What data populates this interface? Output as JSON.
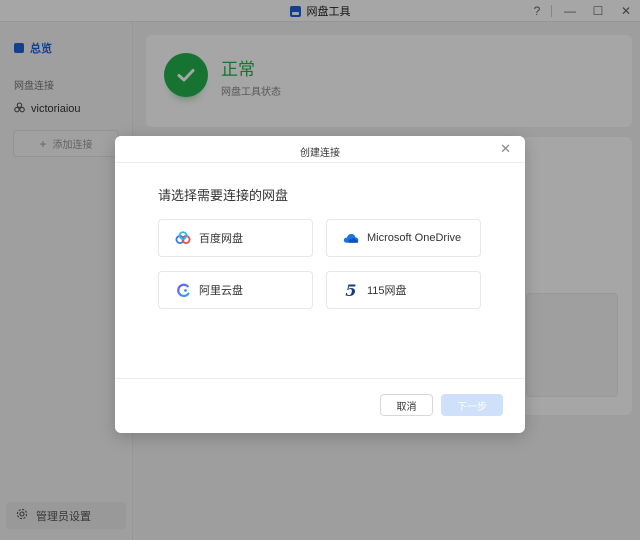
{
  "window": {
    "title": "网盘工具",
    "help": "?",
    "minimize": "—",
    "maximize": "☐",
    "close": "✕"
  },
  "sidebar": {
    "overview": "总览",
    "section_label": "网盘连接",
    "account": "victoriaiou",
    "add_connection": "添加连接",
    "admin_settings": "管理员设置"
  },
  "status": {
    "title": "正常",
    "subtitle": "网盘工具状态"
  },
  "dialog": {
    "title": "创建连接",
    "close": "✕",
    "prompt": "请选择需要连接的网盘",
    "options": [
      {
        "label": "百度网盘",
        "icon": "baidu-netdisk-icon"
      },
      {
        "label": "Microsoft OneDrive",
        "icon": "onedrive-icon"
      },
      {
        "label": "阿里云盘",
        "icon": "aliyun-drive-icon"
      },
      {
        "label": "115网盘",
        "icon": "115-icon",
        "glyph": "5"
      }
    ],
    "cancel": "取消",
    "next": "下一步"
  },
  "colors": {
    "accent": "#1e63d8",
    "success": "#22b14c",
    "next_disabled": "#cfe0fb"
  }
}
